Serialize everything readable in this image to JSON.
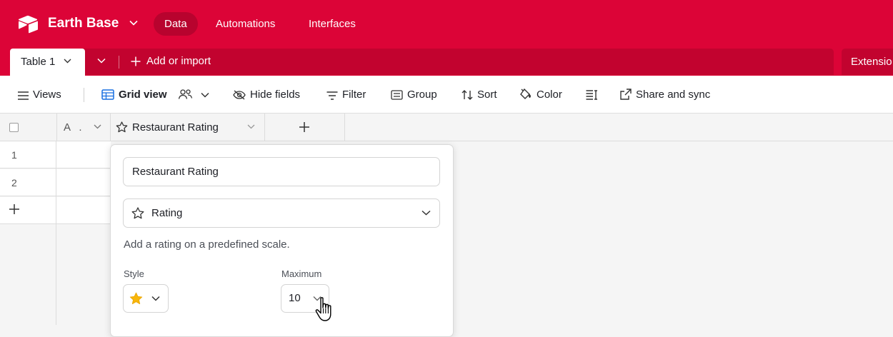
{
  "colors": {
    "brand": "#dc0437",
    "brand_dark": "#c2032f",
    "star": "#f8b60a"
  },
  "header": {
    "base_name": "Earth Base",
    "nav": [
      {
        "label": "Data",
        "active": true
      },
      {
        "label": "Automations",
        "active": false
      },
      {
        "label": "Interfaces",
        "active": false
      }
    ]
  },
  "tabs": {
    "table_tab": "Table 1",
    "add_import": "Add or import",
    "extensions": "Extensio"
  },
  "toolbar": {
    "views": "Views",
    "grid_view": "Grid view",
    "hide_fields": "Hide fields",
    "filter": "Filter",
    "group": "Group",
    "sort": "Sort",
    "color": "Color",
    "share_sync": "Share and sync"
  },
  "grid": {
    "columns": [
      {
        "label": "A .",
        "icon": "text-icon"
      },
      {
        "label": "Restaurant Rating",
        "icon": "star-icon"
      }
    ],
    "rows": [
      "1",
      "2"
    ]
  },
  "field_editor": {
    "field_name": "Restaurant Rating",
    "field_type": "Rating",
    "description": "Add a rating on a predefined scale.",
    "style_label": "Style",
    "style_value_icon": "star-icon",
    "maximum_label": "Maximum",
    "maximum_value": "10"
  }
}
